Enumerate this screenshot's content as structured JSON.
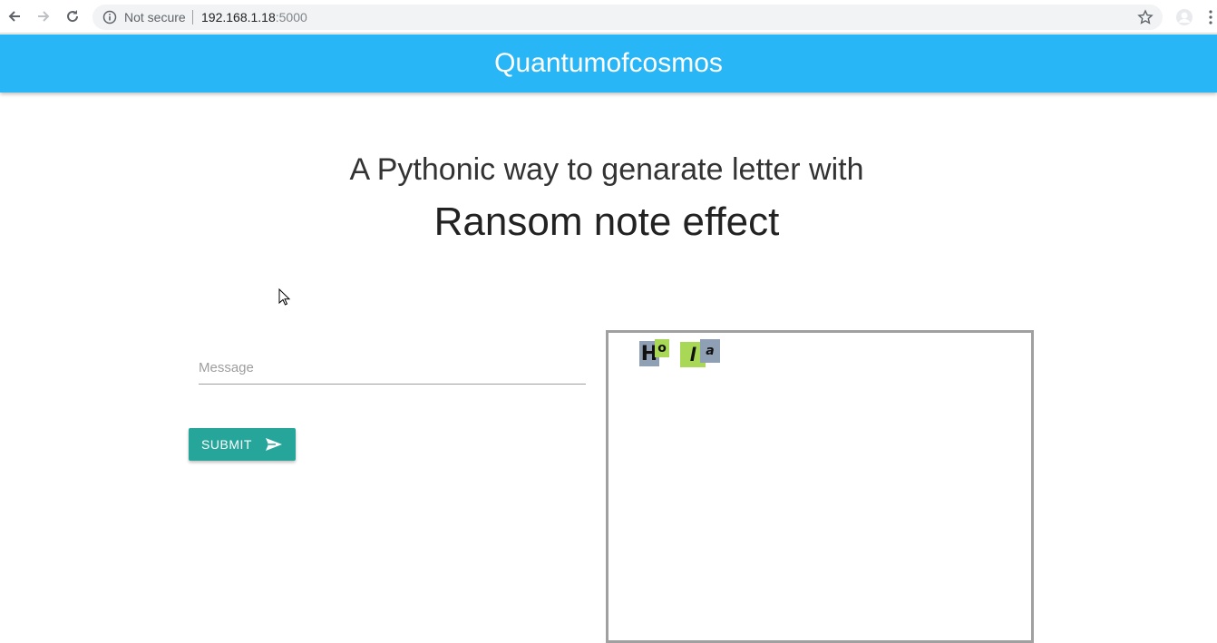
{
  "browser": {
    "security_label": "Not secure",
    "url_host": "192.168.1.18",
    "url_port": ":5000"
  },
  "navbar": {
    "brand": "Quantumofcosmos"
  },
  "hero": {
    "subtitle": "A Pythonic way to genarate letter with",
    "title": "Ransom note effect"
  },
  "form": {
    "message_placeholder": "Message",
    "message_value": "",
    "submit_label": "SUBMIT"
  },
  "output": {
    "letters": [
      {
        "char": "H",
        "bg": "#8fa0b4"
      },
      {
        "char": "o",
        "bg": "#a8d855"
      },
      {
        "char": "l",
        "bg": "#a8d855"
      },
      {
        "char": "a",
        "bg": "#8fa0b4"
      }
    ]
  },
  "colors": {
    "navbar": "#29b6f6",
    "submit": "#26a69a"
  }
}
